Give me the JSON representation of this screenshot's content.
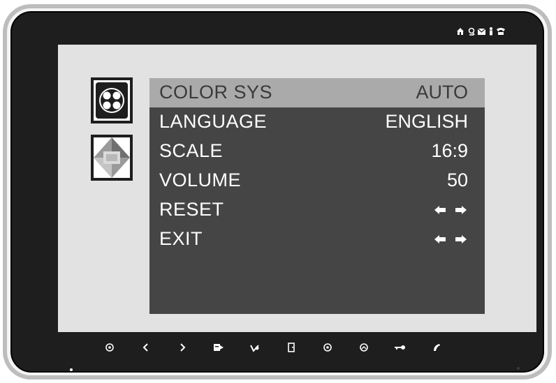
{
  "menu": {
    "rows": [
      {
        "label": "COLOR SYS",
        "value": "AUTO"
      },
      {
        "label": "LANGUAGE",
        "value": "ENGLISH"
      },
      {
        "label": "SCALE",
        "value": "16:9"
      },
      {
        "label": "VOLUME",
        "value": "50"
      },
      {
        "label": "RESET",
        "value": ""
      },
      {
        "label": "EXIT",
        "value": ""
      }
    ],
    "selected_index": 0
  },
  "side_icons": [
    "color-settings-icon",
    "setup-settings-icon"
  ],
  "status_icons": [
    "home-icon",
    "lock-icon",
    "mail-icon",
    "person-icon",
    "phone-icon"
  ],
  "front_buttons": [
    "power-button",
    "left-button",
    "right-button",
    "menu-button",
    "back-button",
    "door-button",
    "ok-button",
    "camera-button",
    "unlock-button",
    "call-button"
  ],
  "colors": {
    "bezel": "#1e1e1e",
    "screen_background": "#e2e2e2",
    "menu_background": "#454545",
    "selected_row": "#aaaaaa"
  }
}
